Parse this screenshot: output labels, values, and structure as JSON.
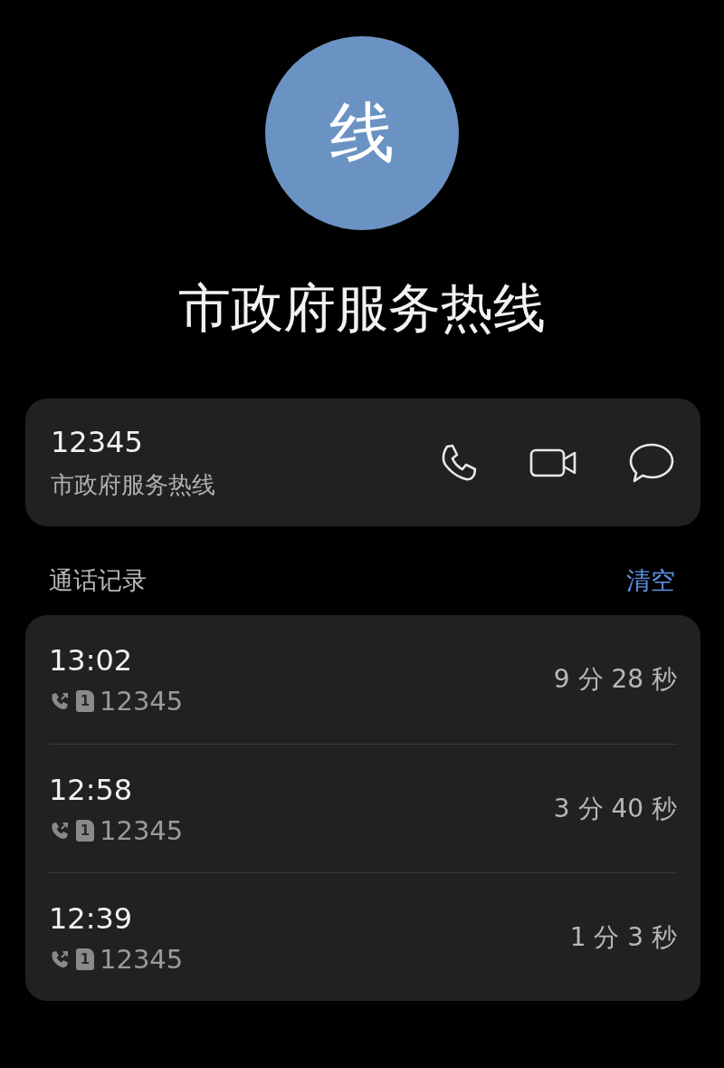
{
  "avatar": {
    "initial": "线"
  },
  "name": "市政府服务热线",
  "contact": {
    "number": "12345",
    "label": "市政府服务热线"
  },
  "history": {
    "title": "通话记录",
    "clear": "清空",
    "calls": [
      {
        "time": "13:02",
        "sim": "1",
        "number": "12345",
        "duration": "9 分 28 秒"
      },
      {
        "time": "12:58",
        "sim": "1",
        "number": "12345",
        "duration": "3 分 40 秒"
      },
      {
        "time": "12:39",
        "sim": "1",
        "number": "12345",
        "duration": "1 分 3 秒"
      }
    ]
  }
}
